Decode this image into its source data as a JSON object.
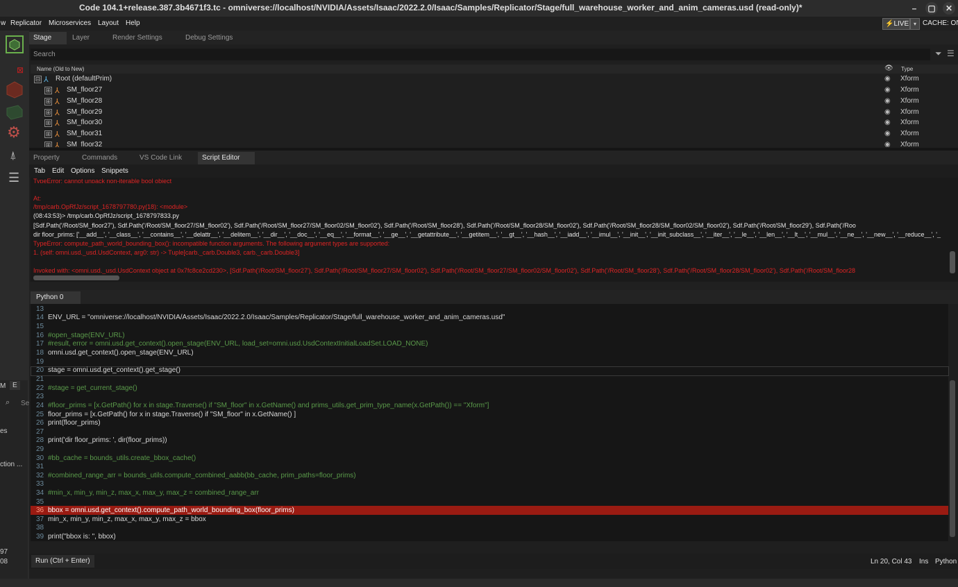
{
  "window": {
    "title": "Code 104.1+release.387.3b4671f3.tc - omniverse://localhost/NVIDIA/Assets/Isaac/2022.2.0/Isaac/Samples/Replicator/Stage/full_warehouse_worker_and_anim_cameras.usd (read-only)*",
    "min_label": "–",
    "max_label": "▢",
    "close_label": "✕"
  },
  "menubar": {
    "items": [
      "w",
      "Replicator",
      "Microservices",
      "Layout",
      "Help"
    ],
    "live_label": "LIVE",
    "cache_label": "CACHE: ON"
  },
  "stage_panel": {
    "tabs": [
      "Stage",
      "Layer",
      "Render Settings",
      "Debug Settings"
    ],
    "active_tab": "Stage",
    "search_placeholder": "Search",
    "col_name": "Name (Old to New)",
    "col_type": "Type",
    "rows": [
      {
        "label": "Root (defaultPrim)",
        "type": "Xform",
        "expander": "⊟"
      },
      {
        "label": "SM_floor27",
        "type": "Xform",
        "expander": "⊞"
      },
      {
        "label": "SM_floor28",
        "type": "Xform",
        "expander": "⊞"
      },
      {
        "label": "SM_floor29",
        "type": "Xform",
        "expander": "⊞"
      },
      {
        "label": "SM_floor30",
        "type": "Xform",
        "expander": "⊞"
      },
      {
        "label": "SM_floor31",
        "type": "Xform",
        "expander": "⊞"
      },
      {
        "label": "SM_floor32",
        "type": "Xform",
        "expander": "⊞"
      }
    ]
  },
  "bottom_tabs": [
    "Property",
    "Commands",
    "VS Code Link",
    "Script Editor"
  ],
  "script_menu": [
    "Tab",
    "Edit",
    "Options",
    "Snippets"
  ],
  "output": [
    {
      "text": "TypeError: cannot unpack non-iterable bool object",
      "color": "red"
    },
    {
      "text": "",
      "color": "red"
    },
    {
      "text": "At:",
      "color": "red"
    },
    {
      "text": "  /tmp/carb.OpRfJz/script_1678797780.py(18): <module>",
      "color": "red"
    },
    {
      "text": "(08:43:53)> /tmp/carb.OpRfJz/script_1678797833.py",
      "color": "white"
    },
    {
      "text": "[Sdf.Path('/Root/SM_floor27'), Sdf.Path('/Root/SM_floor27/SM_floor02'), Sdf.Path('/Root/SM_floor27/SM_floor02/SM_floor02'), Sdf.Path('/Root/SM_floor28'), Sdf.Path('/Root/SM_floor28/SM_floor02'), Sdf.Path('/Root/SM_floor28/SM_floor02/SM_floor02'), Sdf.Path('/Root/SM_floor29'), Sdf.Path('/Roo",
      "color": "white"
    },
    {
      "text": "dir floor_prims:  ['__add__', '__class__', '__contains__', '__delattr__', '__delitem__', '__dir__', '__doc__', '__eq__', '__format__', '__ge__', '__getattribute__', '__getitem__', '__gt__', '__hash__', '__iadd__', '__imul__', '__init__', '__init_subclass__', '__iter__', '__le__', '__len__', '__lt__', '__mul__', '__ne__', '__new__', '__reduce__', '_",
      "color": "white"
    },
    {
      "text": "TypeError: compute_path_world_bounding_box(): incompatible function arguments. The following argument types are supported:",
      "color": "red"
    },
    {
      "text": "    1. (self: omni.usd._usd.UsdContext, arg0: str) -> Tuple[carb._carb.Double3, carb._carb.Double3]",
      "color": "red"
    },
    {
      "text": "",
      "color": "red"
    },
    {
      "text": "Invoked with: <omni.usd._usd.UsdContext object at 0x7fc8ce2cd230>, [Sdf.Path('/Root/SM_floor27'), Sdf.Path('/Root/SM_floor27/SM_floor02'), Sdf.Path('/Root/SM_floor27/SM_floor02/SM_floor02'), Sdf.Path('/Root/SM_floor28'), Sdf.Path('/Root/SM_floor28/SM_floor02'), Sdf.Path('/Root/SM_floor28",
      "color": "red"
    }
  ],
  "editor": {
    "tab": "Python 0",
    "lines": [
      {
        "n": "13",
        "t": "",
        "c": "fn"
      },
      {
        "n": "14",
        "t": "ENV_URL = \"omniverse://localhost/NVIDIA/Assets/Isaac/2022.2.0/Isaac/Samples/Replicator/Stage/full_warehouse_worker_and_anim_cameras.usd\"",
        "c": "mix_env"
      },
      {
        "n": "15",
        "t": "",
        "c": "fn"
      },
      {
        "n": "16",
        "t": "#open_stage(ENV_URL)",
        "c": "cmt"
      },
      {
        "n": "17",
        "t": "#result, error = omni.usd.get_context().open_stage(ENV_URL, load_set=omni.usd.UsdContextInitialLoadSet.LOAD_NONE)",
        "c": "cmt"
      },
      {
        "n": "18",
        "t": "omni.usd.get_context().open_stage(ENV_URL)",
        "c": "fn"
      },
      {
        "n": "19",
        "t": "",
        "c": "fn"
      },
      {
        "n": "20",
        "t": "stage = omni.usd.get_context().get_stage()",
        "c": "fn"
      },
      {
        "n": "21",
        "t": "",
        "c": "fn"
      },
      {
        "n": "22",
        "t": "#stage = get_current_stage()",
        "c": "cmt"
      },
      {
        "n": "23",
        "t": "",
        "c": "fn"
      },
      {
        "n": "24",
        "t": "#floor_prims = [x.GetPath() for x in stage.Traverse() if \"SM_floor\" in x.GetName() and prims_utils.get_prim_type_name(x.GetPath()) == \"Xform\"]",
        "c": "cmt"
      },
      {
        "n": "25",
        "t": "floor_prims = [x.GetPath() for x in stage.Traverse() if \"SM_floor\" in x.GetName() ]",
        "c": "fn"
      },
      {
        "n": "26",
        "t": "print(floor_prims)",
        "c": "fn"
      },
      {
        "n": "27",
        "t": "",
        "c": "fn"
      },
      {
        "n": "28",
        "t": "print('dir floor_prims: ', dir(floor_prims))",
        "c": "fn"
      },
      {
        "n": "29",
        "t": "",
        "c": "fn"
      },
      {
        "n": "30",
        "t": "#bb_cache = bounds_utils.create_bbox_cache()",
        "c": "cmt"
      },
      {
        "n": "31",
        "t": "",
        "c": "fn"
      },
      {
        "n": "32",
        "t": "#combined_range_arr = bounds_utils.compute_combined_aabb(bb_cache, prim_paths=floor_prims)",
        "c": "cmt"
      },
      {
        "n": "33",
        "t": "",
        "c": "fn"
      },
      {
        "n": "34",
        "t": "#min_x, min_y, min_z, max_x, max_y, max_z = combined_range_arr",
        "c": "cmt"
      },
      {
        "n": "35",
        "t": "",
        "c": "fn"
      },
      {
        "n": "36",
        "t": "bbox = omni.usd.get_context().compute_path_world_bounding_box(floor_prims)",
        "c": "fn"
      },
      {
        "n": "37",
        "t": "min_x, min_y, min_z, max_x, max_y, max_z = bbox",
        "c": "fn"
      },
      {
        "n": "38",
        "t": "",
        "c": "fn"
      },
      {
        "n": "39",
        "t": "print(\"bbox is: \", bbox)",
        "c": "fn"
      }
    ],
    "error_line": "36",
    "current_line": "20"
  },
  "statusbar": {
    "run_label": "Run (Ctrl + Enter)",
    "cursor": "Ln 20, Col 43",
    "mode": "Ins",
    "language": "Python"
  },
  "left_clip": {
    "tabs": [
      "M",
      "E"
    ],
    "search": "Se",
    "items": [
      "es",
      "ction ..."
    ],
    "numbers": [
      "97",
      "08"
    ]
  }
}
